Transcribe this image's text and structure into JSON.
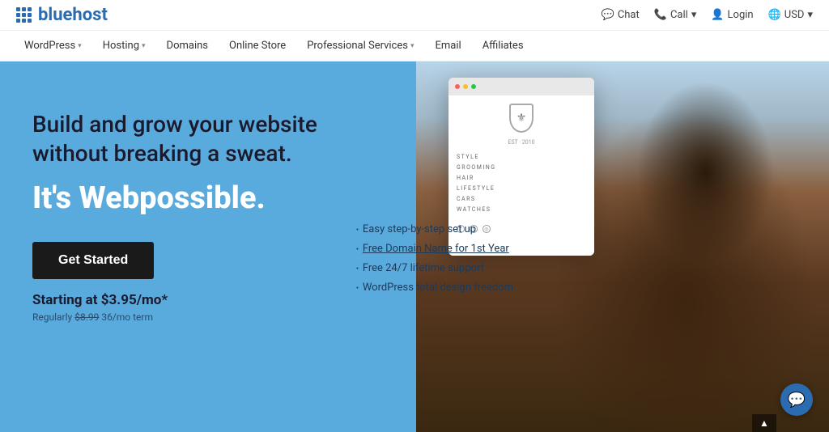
{
  "topbar": {
    "logo_text": "bluehost",
    "chat_label": "Chat",
    "call_label": "Call",
    "call_arrow": "▾",
    "login_label": "Login",
    "currency_label": "USD",
    "currency_arrow": "▾"
  },
  "nav": {
    "items": [
      {
        "label": "WordPress",
        "has_dropdown": true
      },
      {
        "label": "Hosting",
        "has_dropdown": true
      },
      {
        "label": "Domains",
        "has_dropdown": false
      },
      {
        "label": "Online Store",
        "has_dropdown": false
      },
      {
        "label": "Professional Services",
        "has_dropdown": true
      },
      {
        "label": "Email",
        "has_dropdown": false
      },
      {
        "label": "Affiliates",
        "has_dropdown": false
      }
    ]
  },
  "hero": {
    "tagline": "Build and grow your website without breaking a sweat.",
    "headline": "It's Webpossible.",
    "cta_button": "Get Started",
    "pricing_main": "Starting at $3.95/mo*",
    "pricing_sub_prefix": "Regularly ",
    "pricing_original": "$8.99",
    "pricing_term": " 36/mo term",
    "features": [
      {
        "text": "Easy step-by-step set up"
      },
      {
        "text": "Free Domain Name for 1st Year",
        "underline": "Free Domain Name for 1st Year"
      },
      {
        "text": "Free 24/7 lifetime support"
      },
      {
        "text": "WordPress total design freedom"
      }
    ]
  },
  "browser_mockup": {
    "nav_items": [
      "STYLE",
      "GROOMING",
      "HAIR",
      "LIFESTYLE",
      "CARS",
      "WATCHES"
    ]
  },
  "chat": {
    "icon": "💬"
  }
}
